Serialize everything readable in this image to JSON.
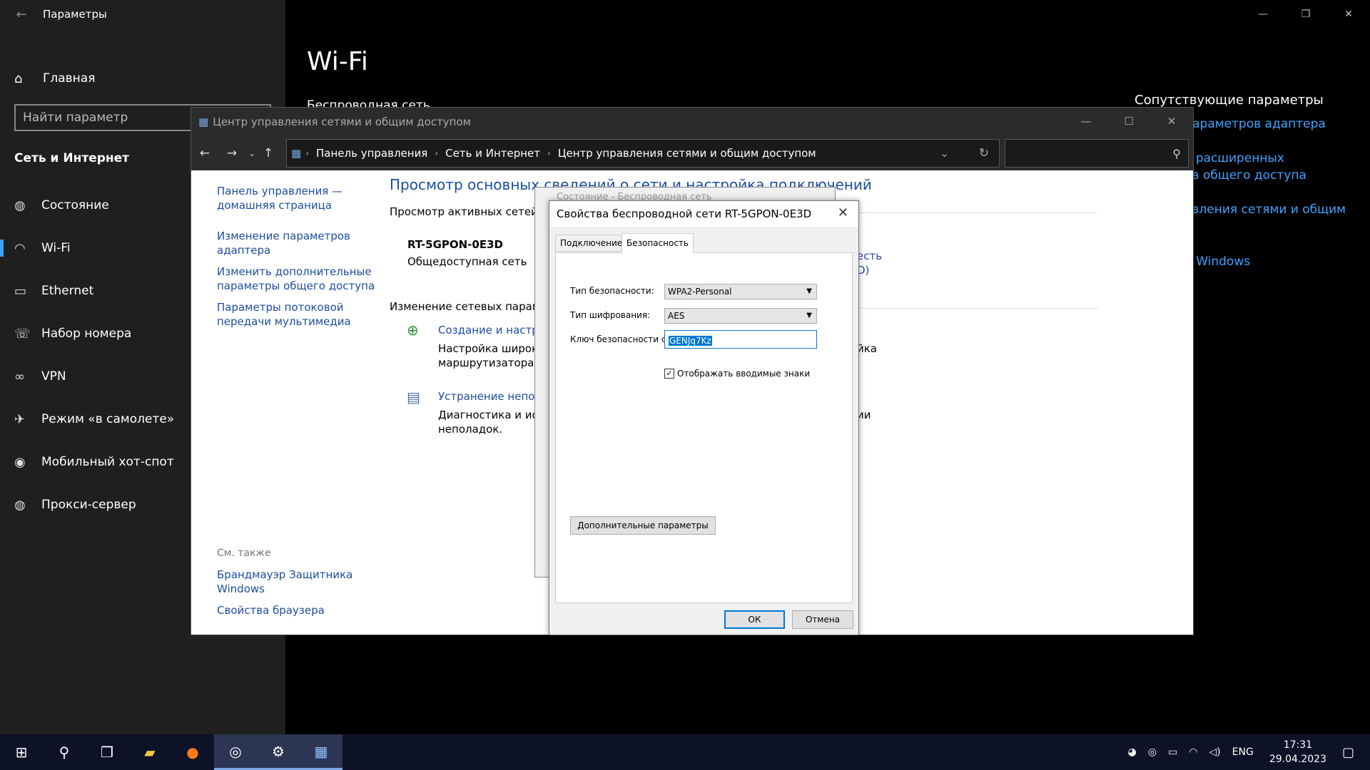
{
  "settings": {
    "app_title": "Параметры",
    "home_label": "Главная",
    "search_placeholder": "Найти параметр",
    "category": "Сеть и Интернет",
    "nav": [
      {
        "label": "Состояние",
        "icon": "globe-icon"
      },
      {
        "label": "Wi-Fi",
        "icon": "wifi-icon"
      },
      {
        "label": "Ethernet",
        "icon": "ethernet-icon"
      },
      {
        "label": "Набор номера",
        "icon": "dialup-icon"
      },
      {
        "label": "VPN",
        "icon": "vpn-icon"
      },
      {
        "label": "Режим «в самолете»",
        "icon": "airplane-icon"
      },
      {
        "label": "Мобильный хот-спот",
        "icon": "hotspot-icon"
      },
      {
        "label": "Прокси-сервер",
        "icon": "globe-icon"
      }
    ],
    "selected_index": 1,
    "page_title": "Wi-Fi",
    "page_subtitle": "Беспроводная сеть",
    "related_title": "Сопутствующие параметры",
    "related_links": [
      "параметров адаптера",
      "е расширенных",
      "ов общего доступа",
      "авления сетями и общим",
      "р Windows"
    ]
  },
  "control_panel": {
    "title": "Центр управления сетями и общим доступом",
    "breadcrumbs": [
      "Панель управления",
      "Сеть и Интернет",
      "Центр управления сетями и общим доступом"
    ],
    "sidebar_links": [
      "Панель управления —",
      "домашняя страница",
      "Изменение параметров",
      "адаптера",
      "Изменить дополнительные",
      "параметры общего доступа",
      "Параметры потоковой",
      "передачи мультимедиа"
    ],
    "see_also_label": "См. также",
    "see_also_links": [
      "Брандмауэр Защитника",
      "Windows",
      "Свойства браузера"
    ],
    "heading": "Просмотр основных сведений о сети и настройка подключений",
    "active_networks_label": "Просмотр активных сетей",
    "network_name": "RT-5GPON-0E3D",
    "network_type": "Общедоступная сеть",
    "change_settings_label": "Изменение сетевых парамет",
    "create_link": "Создание и настрой",
    "create_desc_1": "Настройка широко",
    "create_desc_2": "маршрутизатора ил",
    "troubleshoot_link": "Устранение непола",
    "troubleshoot_desc_1": "Диагностика и испр",
    "troubleshoot_desc_2": "неполадок.",
    "right_fragments": [
      "есть",
      "D)",
      "йка",
      "ии"
    ]
  },
  "status_window": {
    "title": "Состояние - Беспроводная сеть"
  },
  "dialog": {
    "title": "Свойства беспроводной сети RT-5GPON-0E3D",
    "tabs": [
      "Подключение",
      "Безопасность"
    ],
    "active_tab": 1,
    "security_type_label": "Тип безопасности:",
    "security_type_value": "WPA2-Personal",
    "encryption_type_label": "Тип шифрования:",
    "encryption_type_value": "AES",
    "key_label": "Ключ безопасности сети",
    "key_value": "GENJq7Kz",
    "show_chars_label": "Отображать вводимые знаки",
    "show_chars_checked": true,
    "advanced_button": "Дополнительные параметры",
    "ok_button": "ОК",
    "cancel_button": "Отмена"
  },
  "taskbar": {
    "apps": [
      "start-icon",
      "search-icon",
      "task-view-icon",
      "file-explorer-icon",
      "firefox-icon",
      "steam-icon",
      "settings-icon",
      "control-panel-icon"
    ],
    "language": "ENG",
    "time": "17:31",
    "date": "29.04.2023"
  },
  "colors": {
    "accent": "#3fa3ff",
    "link": "#1d4ea1",
    "selection": "#0078d7"
  }
}
